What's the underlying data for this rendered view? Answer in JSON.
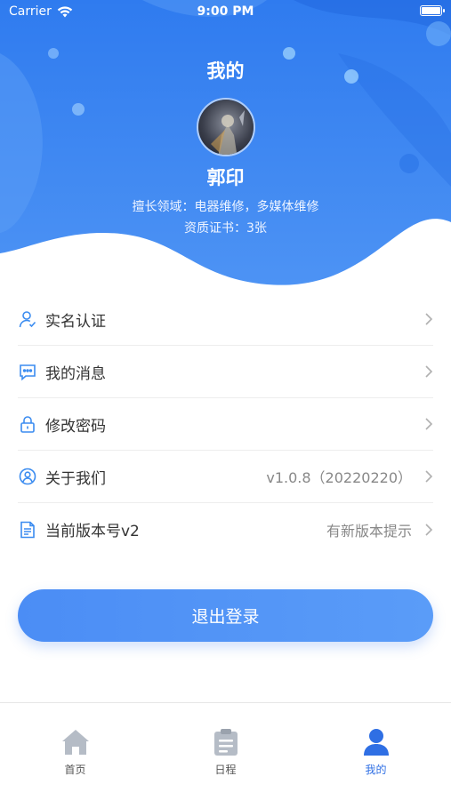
{
  "status_bar": {
    "carrier": "Carrier",
    "time": "9:00 PM"
  },
  "header": {
    "title": "我的",
    "user_name": "郭印",
    "specialty": "擅长领域：电器维修，多媒体维修",
    "certificates": "资质证书：3张"
  },
  "menu": {
    "items": [
      {
        "label": "实名认证",
        "value": "",
        "icon": "user-verify-icon"
      },
      {
        "label": "我的消息",
        "value": "",
        "icon": "message-icon"
      },
      {
        "label": "修改密码",
        "value": "",
        "icon": "lock-icon"
      },
      {
        "label": "关于我们",
        "value": "v1.0.8（20220220）",
        "icon": "about-icon"
      },
      {
        "label": "当前版本号v2",
        "value": "有新版本提示",
        "icon": "document-icon"
      }
    ]
  },
  "logout": {
    "label": "退出登录"
  },
  "tabbar": {
    "tabs": [
      {
        "label": "首页",
        "icon": "home-icon",
        "active": false
      },
      {
        "label": "日程",
        "icon": "clipboard-icon",
        "active": false
      },
      {
        "label": "我的",
        "icon": "person-icon",
        "active": true
      }
    ]
  },
  "colors": {
    "primary": "#3b82f0",
    "tab_active": "#2f6fe4",
    "tab_inactive": "#b5bcc6"
  }
}
